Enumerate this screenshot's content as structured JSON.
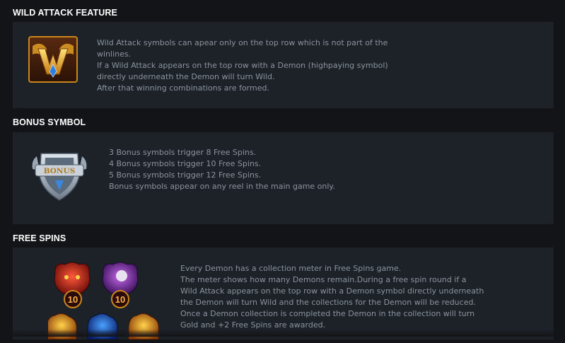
{
  "sections": {
    "wild": {
      "title": "WILD ATTACK FEATURE",
      "icon": "wild-w-emblem",
      "lines": [
        "Wild Attack symbols can apear only on the top row which is not part of the",
        "winlines.",
        "If a Wild Attack appears on the top row with a Demon (highpaying symbol)",
        "directly underneath the Demon will turn Wild.",
        "After that winning combinations are formed."
      ]
    },
    "bonus": {
      "title": "BONUS SYMBOL",
      "icon": "bonus-shield-emblem",
      "icon_text": "BONUS",
      "lines": [
        "3 Bonus symbols trigger 8 Free Spins.",
        "4 Bonus symbols trigger 10 Free Spins.",
        "5 Bonus symbols trigger 12 Free Spins.",
        "Bonus symbols appear on any reel in the main game only."
      ]
    },
    "free": {
      "title": "FREE SPINS",
      "demon_badges": [
        "10",
        "10"
      ],
      "lines": [
        "Every Demon has a collection meter in Free Spins game.",
        "The meter shows how many Demons remain.During a free spin round if a",
        "Wild Attack appears on the top row with a Demon symbol directly underneath",
        "the Demon will turn Wild and the collections for the Demon will be reduced.",
        "Once a Demon collection is completed the Demon in the collection will turn",
        "Gold and +2 Free Spins are awarded."
      ]
    }
  },
  "colors": {
    "background": "#121417",
    "panel": "#1d2229",
    "title": "#ffffff",
    "text": "#8c939c"
  }
}
